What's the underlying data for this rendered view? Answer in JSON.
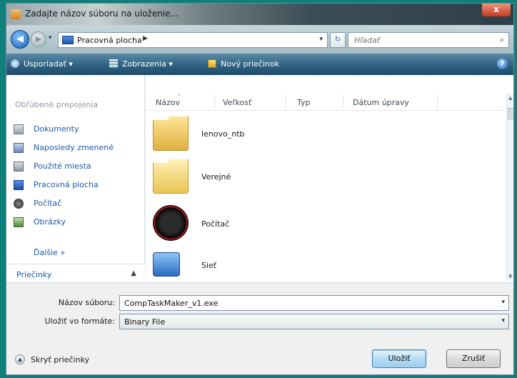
{
  "window": {
    "title": "Zadajte názov súboru na uloženie...",
    "close_label": "x"
  },
  "address": {
    "back_glyph": "◀",
    "forward_glyph": "▶",
    "history_glyph": "▾",
    "location": "Pracovná plocha",
    "crumb_arrow": "▶",
    "dropdown_glyph": "▾",
    "refresh_glyph": "↻",
    "search_placeholder": "Hľadať",
    "search_glyph": "⌕"
  },
  "toolbar": {
    "organize": "Usporiadať  ▾",
    "views": "Zobrazenia  ▾",
    "new_folder": "Nový priečinok",
    "help": "?"
  },
  "navpane": {
    "section_title": "Obľúbené prepojenia",
    "items": [
      {
        "label": "Dokumenty",
        "icon": "documents-icon"
      },
      {
        "label": "Naposledy zmenené",
        "icon": "recent-icon"
      },
      {
        "label": "Použité miesta",
        "icon": "places-icon"
      },
      {
        "label": "Pracovná plocha",
        "icon": "desktop-icon"
      },
      {
        "label": "Počítač",
        "icon": "computer-icon"
      },
      {
        "label": "Obrázky",
        "icon": "pictures-icon"
      }
    ],
    "more_label": "Ďalšie  »",
    "folders_label": "Priečinky",
    "folders_caret": "▲"
  },
  "filelist": {
    "columns": [
      "Názov",
      "Veľkosť",
      "Typ",
      "Dátum úpravy"
    ],
    "sort_glyph": "^",
    "files": [
      {
        "name": "lenovo_ntb",
        "icon": "folder-icon"
      },
      {
        "name": "Verejné",
        "icon": "folder-icon"
      },
      {
        "name": "Počítač",
        "icon": "computer-icon"
      },
      {
        "name": "Sieť",
        "icon": "network-icon"
      }
    ],
    "scroll_up": "▲",
    "scroll_down": "▼"
  },
  "form": {
    "filename_label": "Názov súboru:",
    "filename_value": "CompTaskMaker_v1.exe",
    "filetype_label": "Uložiť vo formáte:",
    "filetype_value": "Binary File",
    "dropdown_glyph": "▾",
    "hide_folders_label": "Skryť priečinky",
    "hide_folders_glyph": "▲",
    "save_label": "Uložiť",
    "cancel_label": "Zrušiť"
  }
}
